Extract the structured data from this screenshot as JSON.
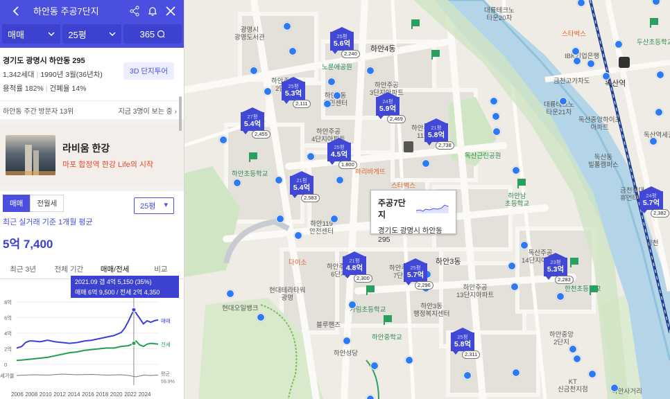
{
  "topbar": {
    "title": "하안동 주공7단지"
  },
  "filters": {
    "deal": "매매",
    "size": "25평",
    "count": "365"
  },
  "complex": {
    "address": "경기도 광명시 하안동 295",
    "households": "1,342세대",
    "built": "1990년 3월(36년차)",
    "far": "용적률 182%",
    "bcr": "건폐율 14%",
    "tour_button": "3D 단지투어"
  },
  "visitors": {
    "rank": "하안동 주간 방문자 13위",
    "now": "지금 3명이 보는 중"
  },
  "ad": {
    "title": "라비움 한강",
    "subtitle": "마포 합정역 한강 Life의 시작"
  },
  "trade_tabs": {
    "sale": "매매",
    "rent": "전월세",
    "size_select": "25평"
  },
  "summary": {
    "basis": "최근 실거래 기준 1개월 평균",
    "price": "5억 7,400"
  },
  "period_tabs": [
    "최근 3년",
    "전체 기간",
    "매매/전세",
    "비교"
  ],
  "chart_tooltip": {
    "line1": "2021.09 갭 4억 5,150 (35%)",
    "line2": "매매 6억 9,500 / 전세 2억 4,350"
  },
  "chart_data": {
    "type": "line",
    "x_ticks": [
      "2006",
      "2008",
      "2010",
      "2012",
      "2014",
      "2016",
      "2018",
      "2020",
      "2022",
      "2024"
    ],
    "y_ticks": [
      "8억",
      "6억",
      "4억",
      "2억",
      "0"
    ],
    "ylim": [
      0,
      8
    ],
    "series": [
      {
        "name": "매매",
        "color": "#3c3fd6",
        "x": [
          2005.8,
          2006.5,
          2007,
          2007.5,
          2008,
          2009,
          2010,
          2011,
          2012,
          2013,
          2014,
          2015,
          2016,
          2017,
          2018,
          2019,
          2020,
          2020.5,
          2021,
          2021.7,
          2022,
          2022.5,
          2023,
          2023.5,
          2024,
          2024.5,
          2025
        ],
        "values": [
          2.1,
          2.3,
          2.8,
          3.0,
          3.0,
          2.9,
          3.1,
          2.9,
          2.8,
          2.7,
          2.8,
          3.0,
          3.1,
          3.3,
          3.5,
          3.7,
          4.1,
          4.7,
          5.6,
          7.0,
          6.6,
          5.9,
          5.2,
          5.6,
          5.4,
          5.6,
          5.7
        ]
      },
      {
        "name": "전세",
        "color": "#20a050",
        "x": [
          2005.8,
          2007,
          2008,
          2009,
          2010,
          2011,
          2012,
          2013,
          2014,
          2015,
          2016,
          2017,
          2018,
          2019,
          2020,
          2021,
          2021.7,
          2022,
          2022.5,
          2023,
          2023.5,
          2024,
          2025
        ],
        "values": [
          0.5,
          0.6,
          0.7,
          0.8,
          0.9,
          1.1,
          1.3,
          1.5,
          1.6,
          1.8,
          1.9,
          2.0,
          2.1,
          2.1,
          2.3,
          2.4,
          2.7,
          3.0,
          2.5,
          2.3,
          2.6,
          2.7,
          2.6
        ]
      },
      {
        "name": "전세가율",
        "color": "#777777",
        "x": [
          2005.8,
          2008,
          2010,
          2012,
          2014,
          2016,
          2018,
          2020,
          2021,
          2022,
          2023,
          2024,
          2025
        ],
        "values": [
          -1.5,
          -1.4,
          -1.45,
          -1.3,
          -1.4,
          -1.35,
          -1.45,
          -1.4,
          -1.5,
          -1.7,
          -1.45,
          -1.5,
          -1.45
        ]
      }
    ],
    "series_labels": {
      "sale": "매매",
      "jeonse": "전세",
      "ratio_label": "평균",
      "ratio_value": "59.9%",
      "ratio_axis": "세가율"
    }
  },
  "map_card": {
    "name": "주공7단지",
    "address": "경기도 광명시 하안동 295"
  },
  "markers": [
    {
      "size": "25평",
      "price": "5.6억",
      "count": "2,240"
    },
    {
      "size": "25평",
      "price": "5.3억",
      "count": "2,111"
    },
    {
      "size": "24평",
      "price": "5.9억",
      "count": "2,469"
    },
    {
      "size": "27평",
      "price": "5.4억",
      "count": "2,455"
    },
    {
      "size": "25평",
      "price": "4.5억",
      "count": "1,800"
    },
    {
      "size": "21평",
      "price": "5.8억",
      "count": "2,738"
    },
    {
      "size": "21평",
      "price": "5.4억",
      "count": "2,583"
    },
    {
      "size": "21평",
      "price": "4.8억",
      "count": "2,300"
    },
    {
      "size": "25평",
      "price": "5.7억",
      "count": "2,296"
    },
    {
      "size": "23평",
      "price": "5.3억",
      "count": "2,283"
    },
    {
      "size": "25평",
      "price": "5.8억",
      "count": "2,311"
    },
    {
      "size": "24평",
      "price": "5.7억",
      "count": "2,382"
    }
  ],
  "map_labels": [
    "광명시\n광명도서관",
    "하안4동",
    "노룬에공원",
    "하안주공\n2단지",
    "하안4동\n주민센터",
    "하안주공\n3단지아파트",
    "하안주공\n4단지아파트",
    "하안주공\n11단",
    "하안동",
    "파리바게뜨",
    "스타벅스",
    "하안초등학교",
    "하안119\n안전센터",
    "다이소",
    "하안주공\n6단지",
    "하안주공\n7단지",
    "하안3동",
    "하안주공\n13단지아파트",
    "하안3동\n행정복지센터",
    "가림초등학교",
    "하안중학교",
    "현대테라타워\n광명",
    "현대오일뱅크",
    "블루핸즈",
    "하안성당",
    "하안남\n초등학교",
    "독산근린공원",
    "대륭테크노\n타운20차",
    "스타벅스",
    "IBK기업은행",
    "금천고가차도",
    "독산역",
    "대륭테크노\n타운21차",
    "독산중앙하이츠\n아파트",
    "독산동\n빌폴캠퍼스",
    "금천현대\n휴먼타운",
    "독산주공\n14단지아파트",
    "하안중앙",
    "하안중앙\n2단지",
    "주공\n7단지아파트",
    "두산초등학교",
    "독산역세권",
    "한천초등학교",
    "하안초",
    "KT\n신금천지점",
    "하안사거리",
    "금천"
  ]
}
